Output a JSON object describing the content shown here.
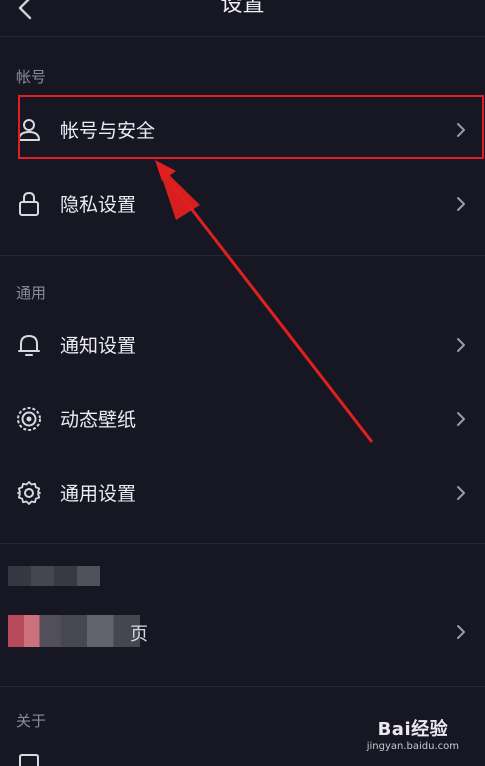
{
  "header": {
    "title": "设置"
  },
  "sections": {
    "account": {
      "label": "帐号",
      "items": [
        {
          "label": "帐号与安全",
          "icon": "person-icon"
        },
        {
          "label": "隐私设置",
          "icon": "lock-icon"
        }
      ]
    },
    "general": {
      "label": "通用",
      "items": [
        {
          "label": "通知设置",
          "icon": "bell-icon"
        },
        {
          "label": "动态壁纸",
          "icon": "live-wallpaper-icon"
        },
        {
          "label": "通用设置",
          "icon": "gear-icon"
        }
      ]
    },
    "blurred": {
      "trailing_char": "页"
    },
    "about": {
      "label": "关于"
    }
  },
  "annotation": {
    "highlight_color": "#e02020",
    "highlight_target": "帐号与安全"
  },
  "watermark": {
    "brand": "Bai经验",
    "url": "jingyan.baidu.com"
  }
}
